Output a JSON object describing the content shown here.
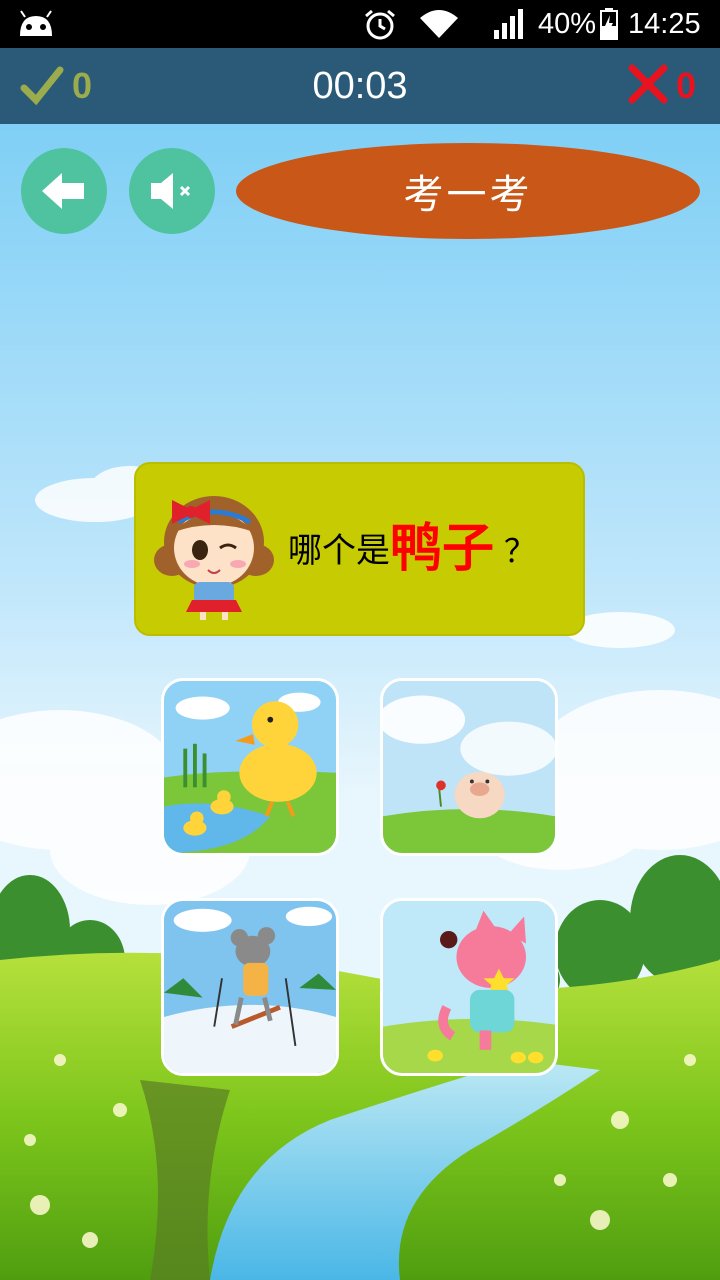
{
  "status_bar": {
    "battery": "40%",
    "time": "14:25",
    "icons": [
      "android-icon",
      "alarm-icon",
      "wifi-icon",
      "signal-icon",
      "battery-charging-icon"
    ]
  },
  "score_bar": {
    "correct_count": "0",
    "timer": "00:03",
    "wrong_count": "0",
    "icons": [
      "check-icon",
      "x-icon"
    ]
  },
  "controls": {
    "back_icon": "back-arrow-icon",
    "sound_icon": "speaker-muted-icon",
    "title": "考一考"
  },
  "question": {
    "prefix": "哪个是",
    "keyword": "鸭子",
    "suffix": "？"
  },
  "options": [
    {
      "name": "duck-option",
      "depicts": "duck"
    },
    {
      "name": "pig-option",
      "depicts": "pig"
    },
    {
      "name": "mouse-option",
      "depicts": "mouse"
    },
    {
      "name": "cat-option",
      "depicts": "cat"
    }
  ],
  "colors": {
    "status_bar": "#000000",
    "score_bar": "#2a5a78",
    "correct": "#9bac4c",
    "wrong": "#e8131e",
    "circle_button": "#4fc3a0",
    "title_pill": "#c95718",
    "question_box": "#c6cb02",
    "keyword": "#ff0000"
  }
}
